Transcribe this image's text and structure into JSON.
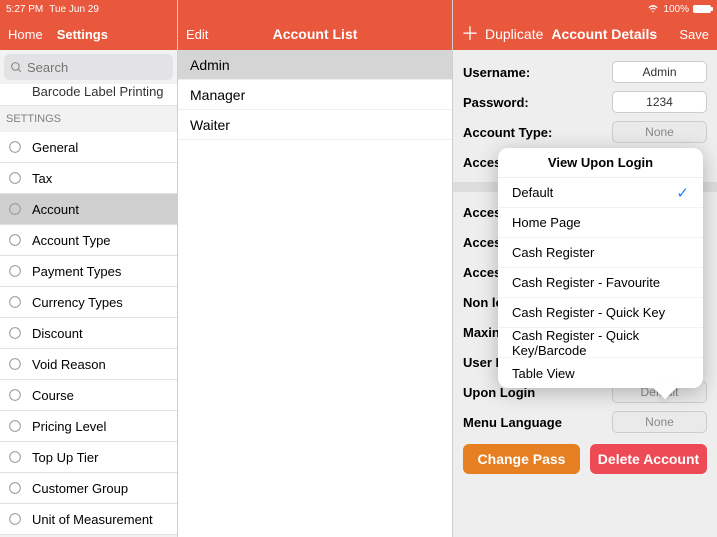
{
  "status": {
    "time": "5:27 PM",
    "date": "Tue Jun 29",
    "battery": "100%"
  },
  "col1": {
    "nav": {
      "home": "Home",
      "settings": "Settings"
    },
    "search_placeholder": "Search",
    "header": "SETTINGS",
    "truncated_top": "Barcode Label Printing",
    "items": [
      {
        "label": "General",
        "selected": false
      },
      {
        "label": "Tax",
        "selected": false
      },
      {
        "label": "Account",
        "selected": true
      },
      {
        "label": "Account Type",
        "selected": false
      },
      {
        "label": "Payment Types",
        "selected": false
      },
      {
        "label": "Currency Types",
        "selected": false
      },
      {
        "label": "Discount",
        "selected": false
      },
      {
        "label": "Void Reason",
        "selected": false
      },
      {
        "label": "Course",
        "selected": false
      },
      {
        "label": "Pricing Level",
        "selected": false
      },
      {
        "label": "Top Up Tier",
        "selected": false
      },
      {
        "label": "Customer Group",
        "selected": false
      },
      {
        "label": "Unit of Measurement",
        "selected": false
      }
    ]
  },
  "col2": {
    "edit": "Edit",
    "title": "Account List",
    "rows": [
      {
        "label": "Admin",
        "selected": true
      },
      {
        "label": "Manager",
        "selected": false
      },
      {
        "label": "Waiter",
        "selected": false
      }
    ]
  },
  "col3": {
    "duplicate": "Duplicate",
    "title": "Account Details",
    "save": "Save",
    "fields": {
      "username_lbl": "Username:",
      "username_val": "Admin",
      "password_lbl": "Password:",
      "password_val": "1234",
      "acct_type_lbl": "Account Type:",
      "acct_type_val": "None",
      "access_lbl": "Access",
      "access2_lbl": "Access",
      "access3_lbl": "Access",
      "access4_lbl": "Access",
      "nonlo_lbl": "Non lo",
      "maxin_lbl": "Maxin",
      "userl_lbl": "User L",
      "uponlogin_lbl": "Upon Login",
      "uponlogin_val": "Default",
      "menulang_lbl": "Menu Language",
      "menulang_val": "None"
    },
    "buttons": {
      "change": "Change Pass",
      "delete": "Delete Account"
    }
  },
  "popover": {
    "title": "View Upon Login",
    "options": [
      {
        "label": "Default",
        "checked": true
      },
      {
        "label": "Home Page",
        "checked": false
      },
      {
        "label": "Cash Register",
        "checked": false
      },
      {
        "label": "Cash Register - Favourite",
        "checked": false
      },
      {
        "label": "Cash Register - Quick Key",
        "checked": false
      },
      {
        "label": "Cash Register - Quick Key/Barcode",
        "checked": false
      },
      {
        "label": "Table View",
        "checked": false
      }
    ]
  }
}
